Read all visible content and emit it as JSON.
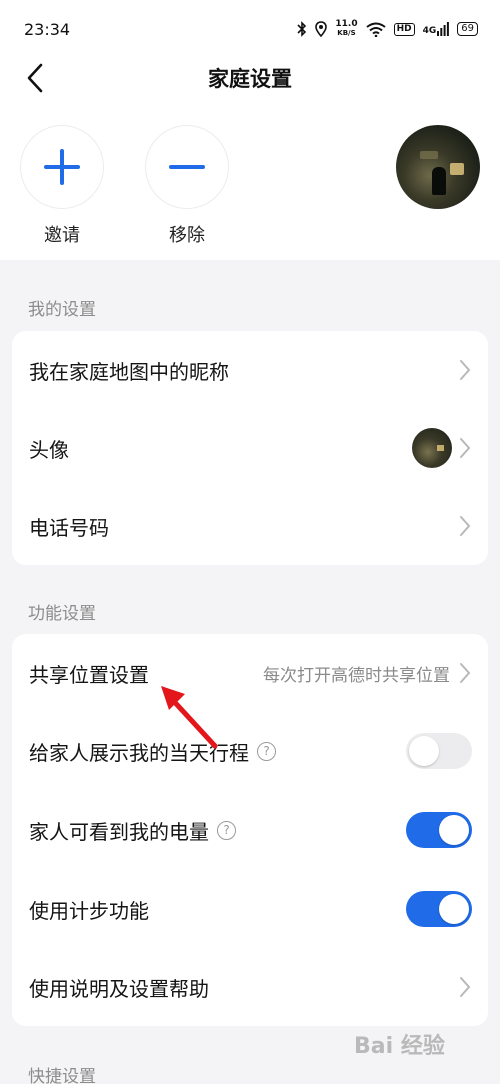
{
  "status_bar": {
    "time": "23:34",
    "net_speed_value": "11.0",
    "net_speed_unit": "KB/S",
    "hd_badge": "HD",
    "network_type": "4G",
    "battery": "69"
  },
  "header": {
    "title": "家庭设置"
  },
  "members": {
    "invite_label": "邀请",
    "remove_label": "移除"
  },
  "my_settings": {
    "section_label": "我的设置",
    "rows": [
      {
        "label": "我在家庭地图中的昵称"
      },
      {
        "label": "头像"
      },
      {
        "label": "电话号码"
      }
    ]
  },
  "feature_settings": {
    "section_label": "功能设置",
    "share_location": {
      "label": "共享位置设置",
      "value": "每次打开高德时共享位置"
    },
    "show_itinerary": {
      "label": "给家人展示我的当天行程",
      "enabled": false
    },
    "show_battery": {
      "label": "家人可看到我的电量",
      "enabled": true
    },
    "step_counter": {
      "label": "使用计步功能",
      "enabled": true
    },
    "help": {
      "label": "使用说明及设置帮助"
    }
  },
  "shortcut_settings": {
    "section_label": "快捷设置"
  },
  "watermark": "Bai 经验",
  "colors": {
    "accent": "#1f6be8",
    "toggle_off": "#ececee",
    "annotation_arrow": "#e3161c"
  },
  "icons": {
    "plus": "plus-icon",
    "minus": "minus-icon",
    "back": "back-arrow-icon",
    "chevron": "chevron-right-icon",
    "help": "question-circle-icon"
  }
}
